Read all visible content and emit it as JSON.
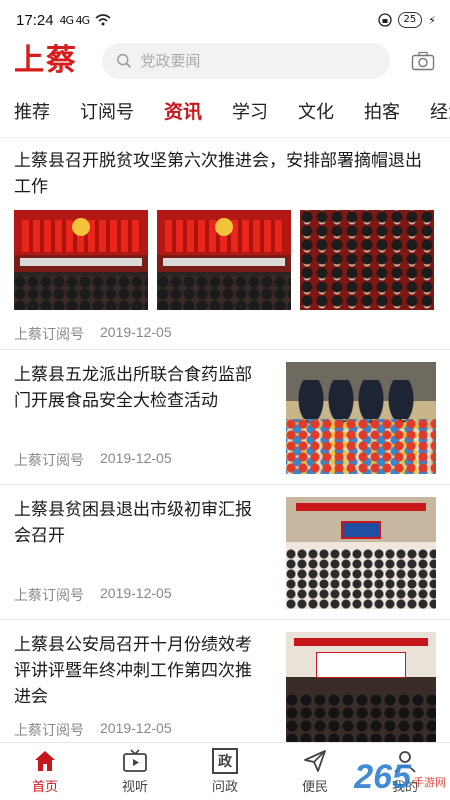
{
  "status_bar": {
    "time": "17:24",
    "network": "4G 4G",
    "battery": "25"
  },
  "header": {
    "logo": "上蔡",
    "search_placeholder": "党政要闻"
  },
  "tabs": [
    {
      "label": "推荐",
      "active": false
    },
    {
      "label": "订阅号",
      "active": false
    },
    {
      "label": "资讯",
      "active": true
    },
    {
      "label": "学习",
      "active": false
    },
    {
      "label": "文化",
      "active": false
    },
    {
      "label": "拍客",
      "active": false
    },
    {
      "label": "经济",
      "active": false
    }
  ],
  "articles": [
    {
      "title": "上蔡县召开脱贫攻坚第六次推进会，安排部署摘帽退出工作",
      "source": "上蔡订阅号",
      "date": "2019-12-05",
      "layout": "three-images"
    },
    {
      "title": "上蔡县五龙派出所联合食药监部门开展食品安全大检查活动",
      "source": "上蔡订阅号",
      "date": "2019-12-05",
      "layout": "right-image"
    },
    {
      "title": "上蔡县贫困县退出市级初审汇报会召开",
      "source": "上蔡订阅号",
      "date": "2019-12-05",
      "layout": "right-image"
    },
    {
      "title": "上蔡县公安局召开十月份绩效考评讲评暨年终冲刺工作第四次推进会",
      "source": "上蔡订阅号",
      "date": "2019-12-05",
      "layout": "right-image"
    }
  ],
  "bottom_nav": [
    {
      "label": "首页",
      "icon": "home-icon",
      "active": true
    },
    {
      "label": "视听",
      "icon": "tv-icon",
      "active": false
    },
    {
      "label": "问政",
      "icon": "inquiry-icon",
      "glyph": "政",
      "active": false
    },
    {
      "label": "便民",
      "icon": "paper-plane-icon",
      "active": false
    },
    {
      "label": "我的",
      "icon": "profile-icon",
      "active": false
    }
  ],
  "watermark": {
    "number": "265",
    "site": "手游网"
  },
  "colors": {
    "brand_red": "#c8161d",
    "logo_red": "#d71b1b",
    "meta_gray": "#888888"
  }
}
